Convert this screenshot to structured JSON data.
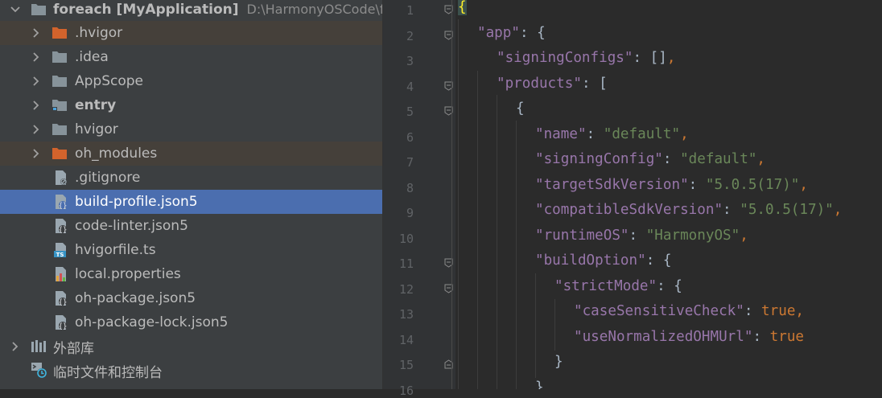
{
  "project_tree": {
    "root": {
      "label": "foreach [MyApplication]",
      "path": "D:\\HarmonyOSCode\\f"
    },
    "items": [
      {
        "label": ".hvigor",
        "type": "folder-excluded",
        "expandable": true
      },
      {
        "label": ".idea",
        "type": "folder",
        "expandable": true
      },
      {
        "label": "AppScope",
        "type": "folder",
        "expandable": true
      },
      {
        "label": "entry",
        "type": "module",
        "expandable": true
      },
      {
        "label": "hvigor",
        "type": "folder",
        "expandable": true
      },
      {
        "label": "oh_modules",
        "type": "folder-excluded",
        "expandable": true
      },
      {
        "label": ".gitignore",
        "type": "file-gitignore"
      },
      {
        "label": "build-profile.json5",
        "type": "file-json5",
        "selected": true
      },
      {
        "label": "code-linter.json5",
        "type": "file-json5"
      },
      {
        "label": "hvigorfile.ts",
        "type": "file-ts"
      },
      {
        "label": "local.properties",
        "type": "file-properties"
      },
      {
        "label": "oh-package.json5",
        "type": "file-json5"
      },
      {
        "label": "oh-package-lock.json5",
        "type": "file-json5"
      }
    ],
    "external_libraries": "外部库",
    "scratches": "临时文件和控制台"
  },
  "editor": {
    "line_numbers": [
      "1",
      "2",
      "3",
      "4",
      "5",
      "6",
      "7",
      "8",
      "9",
      "10",
      "11",
      "12",
      "13",
      "14",
      "15",
      "16"
    ],
    "lines": [
      "{",
      "\"app\": {",
      "\"signingConfigs\": [],",
      "\"products\": [",
      "{",
      "\"name\": \"default\",",
      "\"signingConfig\": \"default\",",
      "\"targetSdkVersion\": \"5.0.5(17)\",",
      "\"compatibleSdkVersion\": \"5.0.5(17)\",",
      "\"runtimeOS\": \"HarmonyOS\",",
      "\"buildOption\": {",
      "\"strictMode\": {",
      "\"caseSensitiveCheck\": true,",
      "\"useNormalizedOHMUrl\": true",
      "}",
      "}"
    ],
    "colors": {
      "key": "#9876aa",
      "string": "#6a8759",
      "keyword": "#cc7832",
      "text": "#a9b7c6"
    }
  }
}
